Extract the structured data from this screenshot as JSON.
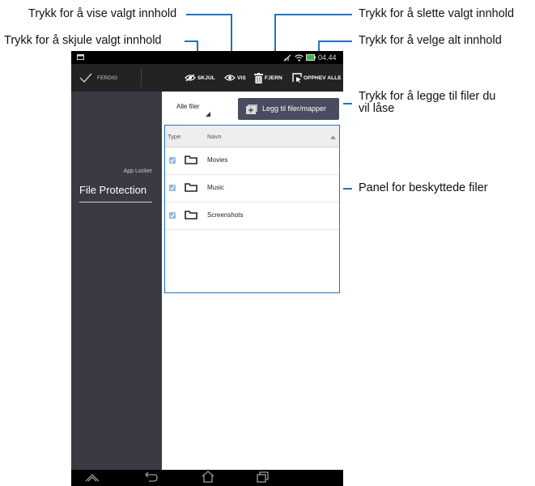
{
  "callouts": {
    "vis": "Trykk for å vise valgt innhold",
    "skjul": "Trykk for å skjule valgt innhold",
    "fjern": "Trykk for å slette valgt innhold",
    "opphev": "Trykk for å velge alt innhold",
    "legg_til_line1": "Trykk for å legge til filer du",
    "legg_til_line2": "vil låse",
    "panel": "Panel for beskyttede filer"
  },
  "status_bar": {
    "time": "04.44"
  },
  "action_bar": {
    "done_label": "FERDIG",
    "hide_label": "SKJUL",
    "show_label": "VIS",
    "remove_label": "FJERN",
    "select_all_label": "OPPHEV ALLE"
  },
  "sidebar": {
    "section_label": "App Locker",
    "selected_item": "File Protection"
  },
  "filter": {
    "selected": "Alle filer"
  },
  "add_button_label": "Legg til filer/mapper",
  "table": {
    "headers": {
      "type": "Type",
      "name": "Navn"
    },
    "rows": [
      {
        "name": "Movies",
        "checked": true
      },
      {
        "name": "Music",
        "checked": true
      },
      {
        "name": "Screenshots",
        "checked": true
      }
    ]
  },
  "colors": {
    "accent": "#1e73c6",
    "action_bar": "#232323",
    "sidebar": "#3a3a42",
    "button": "#4a4b5e"
  }
}
